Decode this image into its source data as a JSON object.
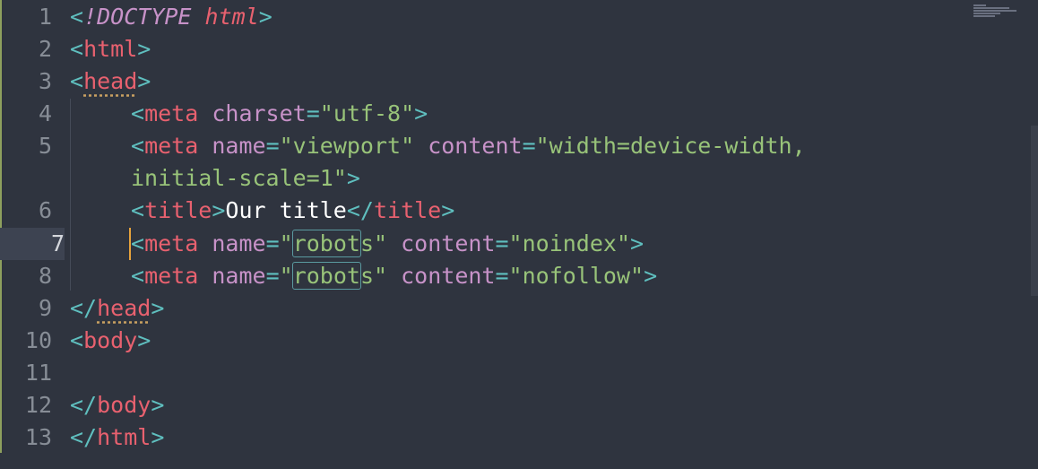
{
  "line_numbers": [
    "1",
    "2",
    "3",
    "4",
    "5",
    "",
    "6",
    "7",
    "8",
    "9",
    "10",
    "11",
    "12",
    "13"
  ],
  "active_line": "7",
  "code": {
    "l1": {
      "lt": "<",
      "bang": "!DOCTYPE",
      "html": "html",
      "gt": ">"
    },
    "l2": {
      "lt": "<",
      "tag": "html",
      "gt": ">"
    },
    "l3": {
      "lt": "<",
      "tag": "head",
      "gt": ">"
    },
    "l4": {
      "lt": "<",
      "tag": "meta",
      "attr": "charset",
      "eq": "=",
      "val": "\"utf-8\"",
      "gt": ">"
    },
    "l5": {
      "lt": "<",
      "tag": "meta",
      "attr1": "name",
      "eq1": "=",
      "val1": "\"viewport\"",
      "attr2": "content",
      "eq2": "=",
      "val2": "\"width=device-width,"
    },
    "l5b": {
      "val": "initial-scale=1\"",
      "gt": ">"
    },
    "l6": {
      "lt": "<",
      "tag": "title",
      "gt": ">",
      "text": "Our title",
      "lt2": "</",
      "tag2": "title",
      "gt2": ">"
    },
    "l7": {
      "lt": "<",
      "tag": "meta",
      "attr1": "name",
      "eq1": "=",
      "q": "\"",
      "match": "robot",
      "rest": "s\"",
      "attr2": "content",
      "eq2": "=",
      "val2": "\"noindex\"",
      "gt": ">"
    },
    "l8": {
      "lt": "<",
      "tag": "meta",
      "attr1": "name",
      "eq1": "=",
      "q": "\"",
      "match": "robot",
      "rest": "s\"",
      "attr2": "content",
      "eq2": "=",
      "val2": "\"nofollow\"",
      "gt": ">"
    },
    "l9": {
      "lt": "</",
      "tag": "head",
      "gt": ">"
    },
    "l10": {
      "lt": "<",
      "tag": "body",
      "gt": ">"
    },
    "l12": {
      "lt": "</",
      "tag": "body",
      "gt": ">"
    },
    "l13": {
      "lt": "</",
      "tag": "html",
      "gt": ">"
    }
  },
  "colors": {
    "background": "#2f343f",
    "tag": "#e8616f",
    "attribute": "#c792c8",
    "string": "#98c379",
    "punctuation": "#5fbfbf",
    "cursor": "#e6a23c"
  }
}
